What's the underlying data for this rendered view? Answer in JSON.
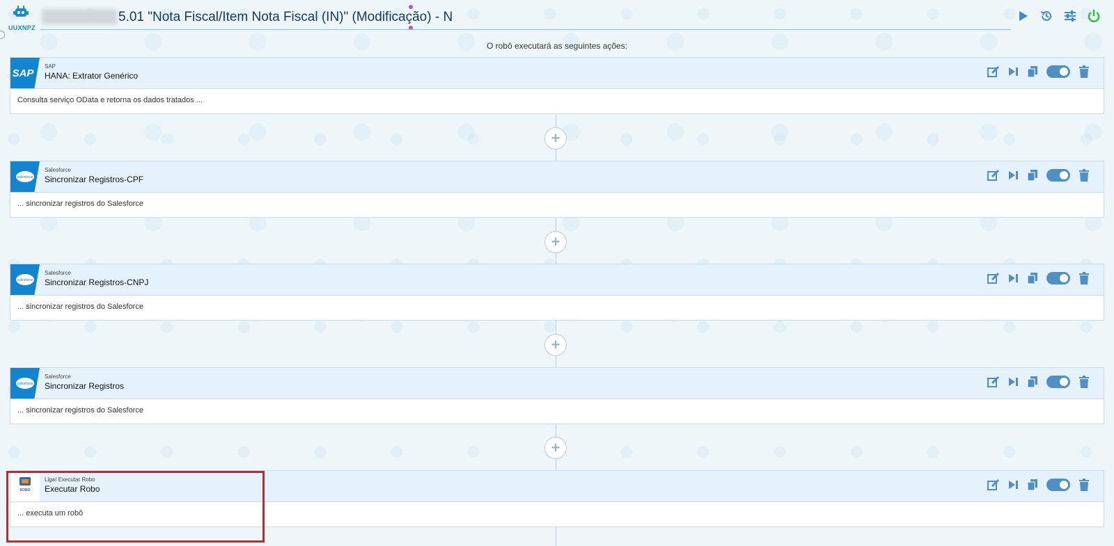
{
  "header": {
    "robot_code": "UUXNPZ",
    "title": "5.01 \"Nota Fiscal/Item Nota Fiscal (IN)\"  (Modificação) - N",
    "icons": [
      "play-icon",
      "history-icon",
      "settings-sliders-icon",
      "power-icon"
    ]
  },
  "subtitle": "O robô executará as seguintes ações:",
  "actions": [
    {
      "provider": "SAP",
      "name": "HANA: Extrator Genérico",
      "description": "Consulta serviço OData e retorna os dados tratados ...",
      "badge_text": "SAP"
    },
    {
      "provider": "Salesforce",
      "name": "Sincronizar Registros-CPF",
      "description": "... sincronizar registros do Salesforce",
      "badge_text": "salesforce"
    },
    {
      "provider": "Salesforce",
      "name": "Sincronizar Registros-CNPJ",
      "description": "... sincronizar registros do Salesforce",
      "badge_text": "salesforce"
    },
    {
      "provider": "Salesforce",
      "name": "Sincronizar Registros",
      "description": "... sincronizar registros do Salesforce",
      "badge_text": "salesforce"
    },
    {
      "provider": "Ligaí Executar Robo",
      "name": "Executar Robo",
      "description": "... executa um robô",
      "badge_text": "ROBÔ"
    }
  ],
  "card_action_icons": [
    "edit-icon",
    "step-forward-icon",
    "copy-icon",
    "toggle-switch",
    "trash-icon"
  ],
  "colors": {
    "accent": "#4f8fc4",
    "title": "#0d3a5e",
    "highlight": "#d42020",
    "badge": "#1384cf"
  }
}
